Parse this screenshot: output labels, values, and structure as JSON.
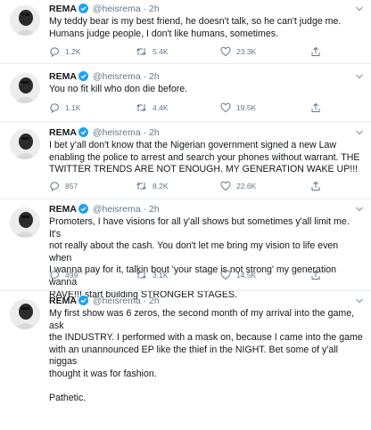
{
  "user": {
    "name": "REMA",
    "handle": "@heisrema",
    "separator": "·"
  },
  "colors": {
    "verified": "#1da1f2",
    "muted": "#657786",
    "text": "#14171a",
    "divider": "#e6ecf0"
  },
  "tweets": [
    {
      "time": "2h",
      "lines": [
        "My teddy bear is my best friend, he doesn't talk, so he can't judge me.",
        "Humans judge people, I don't like humans, sometimes."
      ],
      "replies": "1.2K",
      "retweets": "5.4K",
      "likes": "23.3K"
    },
    {
      "time": "2h",
      "lines": [
        "You no fit kill who don die before."
      ],
      "replies": "1.1K",
      "retweets": "4.4K",
      "likes": "19.5K"
    },
    {
      "time": "2h",
      "lines": [
        "I bet y'all don't know that the Nigerian government signed a new Law",
        "enabling the police to arrest and search your phones without warrant. THE",
        "TWITTER TRENDS ARE NOT ENOUGH. MY GENERATION WAKE UP!!!"
      ],
      "replies": "857",
      "retweets": "8.2K",
      "likes": "22.6K"
    },
    {
      "time": "2h",
      "lines": [
        "Promoters, I have visions for all y'all shows but sometimes y'all limit me. It's",
        "not really about the cash. You don't let me bring my vision to life even when",
        "I wanna pay for it, talkin bout 'your stage is not strong' my generation wanna",
        "RAVE!!! start building STRONGER STAGES."
      ],
      "replies": "499",
      "retweets": "3.1K",
      "likes": "14.5K"
    },
    {
      "time": "2h",
      "lines": [
        "My first show was 6 zeros, the second month of my arrival into the game, ask",
        "the INDUSTRY. I performed with a mask on, because I came into the game",
        "with an unannounced EP like the thief in the NIGHT. Bet some of y'all niggas",
        "thought it was for fashion.",
        "",
        "Pathetic."
      ],
      "replies": "",
      "retweets": "",
      "likes": ""
    }
  ]
}
